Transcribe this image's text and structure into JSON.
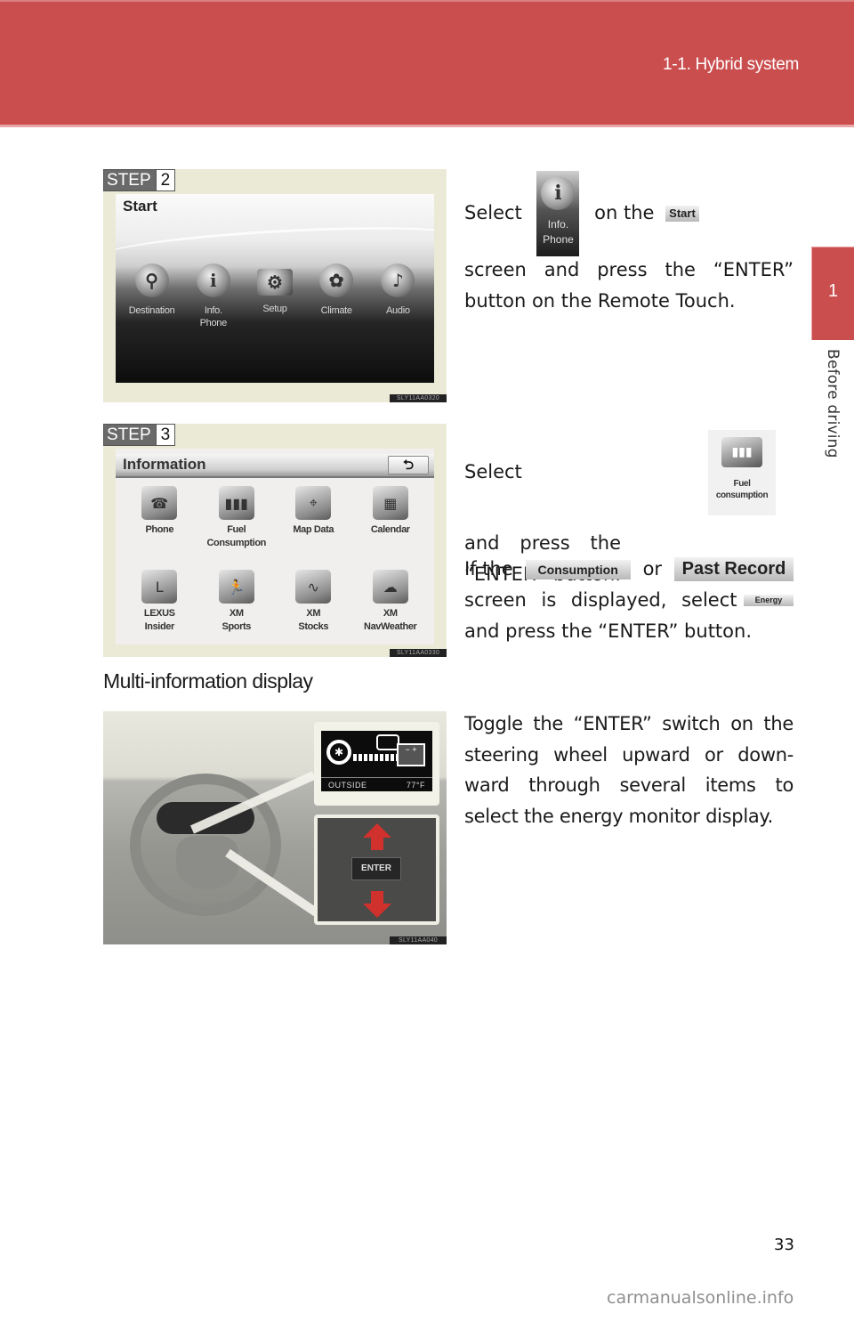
{
  "header": {
    "section_title": "1-1. Hybrid system",
    "color": "#cb4e4f"
  },
  "side_tab": {
    "chapter_number": "1",
    "chapter_label": "Before driving"
  },
  "step2": {
    "step_word": "STEP",
    "step_number": "2",
    "figure_code": "SLY11AA0320",
    "screen": {
      "title": "Start",
      "items": [
        {
          "label": "Destination",
          "icon": "magnifier-pin-icon",
          "glyph": "⚲"
        },
        {
          "label": "Info.\nPhone",
          "icon": "info-icon",
          "glyph": "i"
        },
        {
          "label": "Setup",
          "icon": "setup-gear-icon",
          "glyph": "⚙"
        },
        {
          "label": "Climate",
          "icon": "climate-seat-icon",
          "glyph": "✿"
        },
        {
          "label": "Audio",
          "icon": "music-note-icon",
          "glyph": "♪"
        }
      ]
    },
    "instruction": {
      "before_icon": "Select",
      "icon_label": "Info.\nPhone",
      "after_icon": "on the",
      "chip": "Start",
      "after_chip": "screen and press the “ENTER” button on the Remote Touch."
    }
  },
  "step3": {
    "step_word": "STEP",
    "step_number": "3",
    "figure_code": "SLY11AA0330",
    "screen": {
      "title": "Information",
      "back_glyph": "⮌",
      "items": [
        {
          "label": "Phone",
          "icon": "phone-icon",
          "glyph": "☎"
        },
        {
          "label": "Fuel\nConsumption",
          "icon": "bar-chart-icon",
          "glyph": "▮▮▮"
        },
        {
          "label": "Map Data",
          "icon": "map-data-icon",
          "glyph": "⌖"
        },
        {
          "label": "Calendar",
          "icon": "calendar-icon",
          "glyph": "▦"
        },
        {
          "label": "LEXUS\nInsider",
          "icon": "lexus-logo-icon",
          "glyph": "L"
        },
        {
          "label": "XM\nSports",
          "icon": "runner-icon",
          "glyph": "🏃"
        },
        {
          "label": "XM\nStocks",
          "icon": "stock-chart-icon",
          "glyph": "∿"
        },
        {
          "label": "XM\nNavWeather",
          "icon": "weather-cloud-sun-icon",
          "glyph": "☁"
        }
      ]
    },
    "instruction": {
      "before_icon": "Select",
      "icon_label": "Fuel\nconsumption",
      "after_icon": "and press the “ENTER” button.",
      "line2_prefix": "If the",
      "chip_consumption": "Consumption",
      "line2_or": "or",
      "chip_past_record": "Past Record",
      "line3_prefix": "screen is displayed, select",
      "chip_energy": "Energy",
      "line4": "and press the “ENTER” button."
    }
  },
  "multi_info": {
    "heading": "Multi-information display",
    "figure_code": "SLY11AA040",
    "display": {
      "outside_label": "OUTSIDE",
      "temperature": "77°F"
    },
    "enter_label": "ENTER",
    "instruction": "Toggle the “ENTER” switch on the steering wheel upward or down-ward through several items to select the energy monitor display."
  },
  "footer": {
    "page_number": "33",
    "watermark": "carmanualsonline.info"
  }
}
